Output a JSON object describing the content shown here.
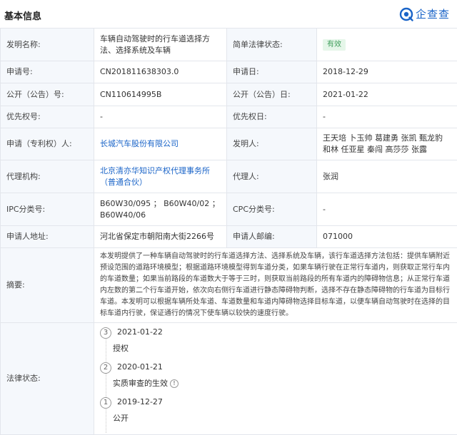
{
  "section_title": "基本信息",
  "brand": {
    "name": "企查查",
    "color": "#1a64c8"
  },
  "fields": {
    "invention_name": {
      "label": "发明名称:",
      "value": "车辆自动驾驶时的行车道选择方法、选择系统及车辆"
    },
    "legal_status_brief": {
      "label": "简单法律状态:",
      "value": "有效"
    },
    "app_no": {
      "label": "申请号:",
      "value": "CN201811638303.0"
    },
    "app_date": {
      "label": "申请日:",
      "value": "2018-12-29"
    },
    "pub_no": {
      "label": "公开（公告）号:",
      "value": "CN110614995B"
    },
    "pub_date": {
      "label": "公开（公告）日:",
      "value": "2021-01-22"
    },
    "priority_no": {
      "label": "优先权号:",
      "value": "-"
    },
    "priority_date": {
      "label": "优先权日:",
      "value": "-"
    },
    "applicant": {
      "label": "申请（专利权）人:",
      "value": "长城汽车股份有限公司"
    },
    "inventor": {
      "label": "发明人:",
      "value": "王天培 卜玉帅 葛建勇 张凯 甄龙豹 和林 任亚星 秦闯 高莎莎 张露"
    },
    "agency": {
      "label": "代理机构:",
      "value": "北京清亦华知识产权代理事务所（普通合伙）"
    },
    "agent": {
      "label": "代理人:",
      "value": "张润"
    },
    "ipc": {
      "label": "IPC分类号:",
      "value": "B60W30/095 ； B60W40/02 ； B60W40/06"
    },
    "cpc": {
      "label": "CPC分类号:",
      "value": "-"
    },
    "address": {
      "label": "申请人地址:",
      "value": "河北省保定市朝阳南大街2266号"
    },
    "postcode": {
      "label": "申请人邮编:",
      "value": "071000"
    },
    "abstract": {
      "label": "摘要:",
      "value": "本发明提供了一种车辆自动驾驶时的行车道选择方法、选择系统及车辆，该行车道选择方法包括：提供车辆附近预设范围的道路环境模型；根据道路环境模型得到车道分类，如果车辆行驶在正常行车道内，则获取正常行车内的车道数量；如果当前路段的车道数大于等于三时，则获取当前路段的所有车道内的障碍物信息；从正常行车道内左数的第二个行车道开始，依次向右侧行车道进行静态障碍物判断，选择不存在静态障碍物的行车道为目标行车道。本发明可以根据车辆所处车道、车道数量和车道内障碍物选择目标车道，以便车辆自动驾驶时在选择的目标车道内行驶，保证通行的情况下使车辆以较快的速度行驶。"
    },
    "legal_status": {
      "label": "法律状态:"
    }
  },
  "timeline": [
    {
      "number": "3",
      "date": "2021-01-22",
      "status": "授权",
      "info": false
    },
    {
      "number": "2",
      "date": "2020-01-21",
      "status": "实质审查的生效",
      "info": true
    },
    {
      "number": "1",
      "date": "2019-12-27",
      "status": "公开",
      "info": false
    }
  ],
  "colors": {
    "link": "#1a64c8",
    "badge_bg": "#e5f6e9",
    "badge_text": "#3f9e5b",
    "label_bg": "#f5f8fc",
    "border": "#e3e6ec"
  }
}
